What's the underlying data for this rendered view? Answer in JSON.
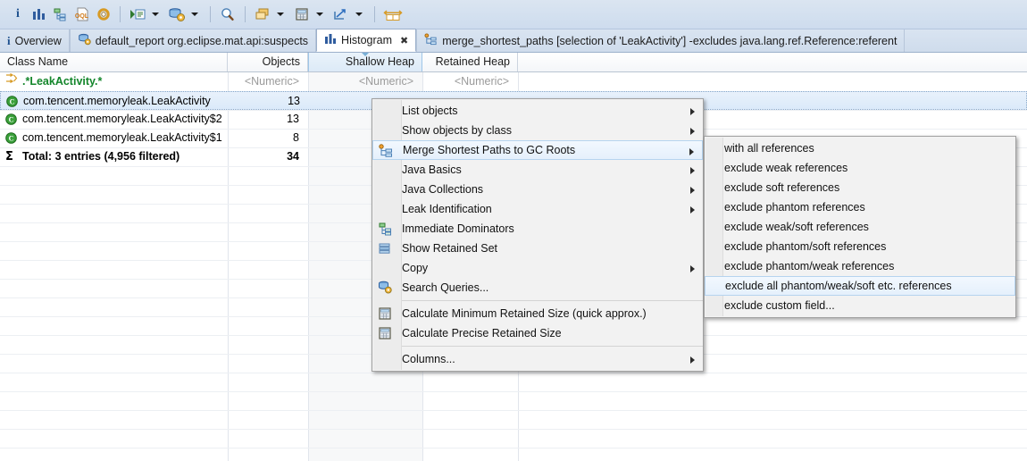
{
  "toolbar": {
    "items": [
      {
        "name": "overview-info-icon",
        "glyph": "i"
      },
      {
        "name": "histogram-icon",
        "glyph": "bars"
      },
      {
        "name": "dominator-tree-icon",
        "glyph": "tree"
      },
      {
        "name": "oql-icon",
        "glyph": "oql"
      },
      {
        "name": "query-browser-icon",
        "glyph": "gear"
      },
      {
        "name": "separator",
        "glyph": "sep"
      },
      {
        "name": "run-expert-system-icon",
        "glyph": "play-list"
      },
      {
        "name": "run-expert-system-dropdown",
        "glyph": "arrow"
      },
      {
        "name": "query-browser-db-icon",
        "glyph": "db-gear"
      },
      {
        "name": "query-browser-dropdown",
        "glyph": "arrow"
      },
      {
        "name": "separator",
        "glyph": "sep"
      },
      {
        "name": "find-icon",
        "glyph": "magnifier"
      },
      {
        "name": "separator",
        "glyph": "sep"
      },
      {
        "name": "group-by-icon",
        "glyph": "stack"
      },
      {
        "name": "group-by-dropdown",
        "glyph": "arrow"
      },
      {
        "name": "calculator-icon",
        "glyph": "calc"
      },
      {
        "name": "calculator-dropdown",
        "glyph": "arrow"
      },
      {
        "name": "export-icon",
        "glyph": "export"
      },
      {
        "name": "export-dropdown",
        "glyph": "arrow"
      },
      {
        "name": "separator",
        "glyph": "sep"
      },
      {
        "name": "compare-icon",
        "glyph": "compare"
      }
    ]
  },
  "tabs": [
    {
      "label": "Overview",
      "icon": "info-icon",
      "active": false,
      "closable": false
    },
    {
      "label": "default_report  org.eclipse.mat.api:suspects",
      "icon": "report-icon",
      "active": false,
      "closable": false
    },
    {
      "label": "Histogram",
      "icon": "histogram-icon",
      "active": true,
      "closable": true
    },
    {
      "label": "merge_shortest_paths [selection of 'LeakActivity'] -excludes java.lang.ref.Reference:referent",
      "icon": "merge-paths-icon",
      "active": false,
      "closable": false
    }
  ],
  "table": {
    "columns": [
      {
        "label": "Class Name",
        "align": "left",
        "sorted": false
      },
      {
        "label": "Objects",
        "align": "right",
        "sorted": false
      },
      {
        "label": "Shallow Heap",
        "align": "right",
        "sorted": true
      },
      {
        "label": "Retained Heap",
        "align": "right",
        "sorted": false
      }
    ],
    "filter_row": {
      "pattern": ".*LeakActivity.*",
      "objects": "<Numeric>",
      "shallow": "<Numeric>",
      "retained": "<Numeric>"
    },
    "rows": [
      {
        "icon": "class-icon",
        "name": "com.tencent.memoryleak.LeakActivity",
        "objects": "13",
        "shallow": "",
        "retained": "",
        "selected": true
      },
      {
        "icon": "class-icon",
        "name": "com.tencent.memoryleak.LeakActivity$2",
        "objects": "13",
        "shallow": "",
        "retained": "",
        "selected": false
      },
      {
        "icon": "class-icon",
        "name": "com.tencent.memoryleak.LeakActivity$1",
        "objects": "8",
        "shallow": "",
        "retained": "",
        "selected": false
      },
      {
        "icon": "sum-icon",
        "name": "Total: 3 entries (4,956 filtered)",
        "objects": "34",
        "shallow": "",
        "retained": "",
        "selected": false,
        "total": true
      }
    ]
  },
  "context_menu": {
    "items": [
      {
        "label": "List objects",
        "icon": null,
        "submenu": true,
        "highlighted": false
      },
      {
        "label": "Show objects by class",
        "icon": null,
        "submenu": true,
        "highlighted": false
      },
      {
        "label": "Merge Shortest Paths to GC Roots",
        "icon": "merge-paths-icon",
        "submenu": true,
        "highlighted": true
      },
      {
        "label": "Java Basics",
        "icon": null,
        "submenu": true,
        "highlighted": false
      },
      {
        "label": "Java Collections",
        "icon": null,
        "submenu": true,
        "highlighted": false
      },
      {
        "label": "Leak Identification",
        "icon": null,
        "submenu": true,
        "highlighted": false
      },
      {
        "label": "Immediate Dominators",
        "icon": "dominators-icon",
        "submenu": false,
        "highlighted": false
      },
      {
        "label": "Show Retained Set",
        "icon": "retained-set-icon",
        "submenu": false,
        "highlighted": false
      },
      {
        "label": "Copy",
        "icon": null,
        "submenu": true,
        "highlighted": false
      },
      {
        "label": "Search Queries...",
        "icon": "search-queries-icon",
        "submenu": false,
        "highlighted": false
      },
      {
        "separator": true
      },
      {
        "label": "Calculate Minimum Retained Size (quick approx.)",
        "icon": "calculator-icon",
        "submenu": false,
        "highlighted": false
      },
      {
        "label": "Calculate Precise Retained Size",
        "icon": "calculator-icon",
        "submenu": false,
        "highlighted": false
      },
      {
        "separator": true
      },
      {
        "label": "Columns...",
        "icon": null,
        "submenu": true,
        "highlighted": false
      }
    ]
  },
  "submenu": {
    "items": [
      {
        "label": "with all references",
        "highlighted": false
      },
      {
        "label": "exclude weak references",
        "highlighted": false
      },
      {
        "label": "exclude soft references",
        "highlighted": false
      },
      {
        "label": "exclude phantom references",
        "highlighted": false
      },
      {
        "label": "exclude weak/soft references",
        "highlighted": false
      },
      {
        "label": "exclude phantom/soft references",
        "highlighted": false
      },
      {
        "label": "exclude phantom/weak references",
        "highlighted": false
      },
      {
        "label": "exclude all phantom/weak/soft etc. references",
        "highlighted": true
      },
      {
        "label": "exclude custom field...",
        "highlighted": false
      }
    ]
  },
  "colors": {
    "toolbar_bg": "#d6e1ef",
    "tab_active_bg": "#ffffff",
    "selection_blue": "#dbeafa",
    "sorted_col_header": "#dceaf7",
    "class_green": "#14862b",
    "menu_bg": "#f2f2f2",
    "menu_highlight": "#e5f0fc"
  }
}
